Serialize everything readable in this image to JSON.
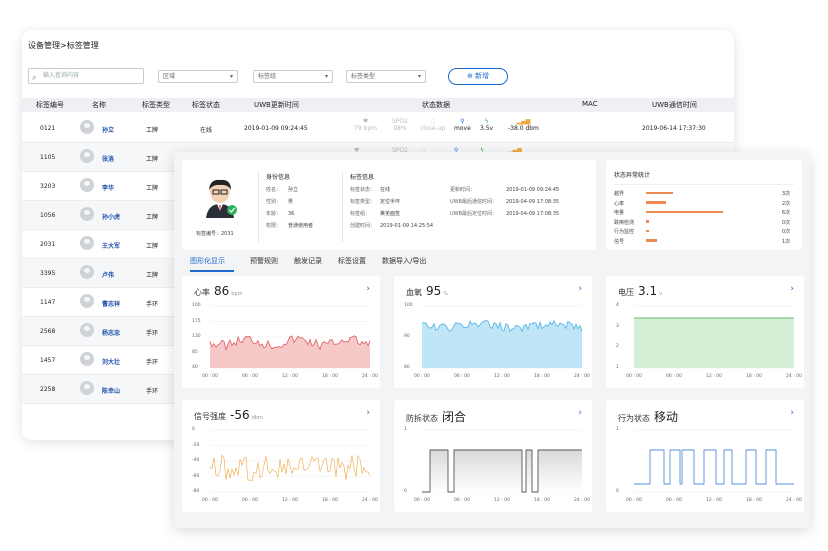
{
  "breadcrumb": "设备管理>标签管理",
  "toolbar": {
    "search_placeholder": "输入查询内容",
    "filter1": "区域",
    "filter2": "标签组",
    "filter3": "标签类型",
    "add_label": "新增"
  },
  "table": {
    "headers": [
      "标签编号",
      "名称",
      "标签类型",
      "标签状态",
      "UWB更新时间",
      "状态数据",
      "MAC",
      "UWB通信时间"
    ],
    "rows": [
      {
        "id": "0121",
        "name": "孙立",
        "type": "工牌",
        "status": "在线",
        "uwb_time": "2019-01-09 09:24:45",
        "hr": "79 bpm",
        "spo2": "98%",
        "motion": "move",
        "volt": "3.5v",
        "signal": "-38.0 dbm",
        "comm_time": "2019-06-14 17:37:30",
        "state_labels": [
          "SPO2",
          "close-up"
        ]
      },
      {
        "id": "1105",
        "name": "张洛",
        "type": "工牌",
        "status": "",
        "uwb_time": "",
        "hr": "",
        "spo2": "",
        "motion": "",
        "volt": "",
        "signal": "",
        "comm_time": "",
        "state_labels": [
          "SPO2",
          ""
        ]
      },
      {
        "id": "3203",
        "name": "李华",
        "type": "工牌"
      },
      {
        "id": "1056",
        "name": "孙小虎",
        "type": "工牌"
      },
      {
        "id": "2031",
        "name": "王大军",
        "type": "工牌"
      },
      {
        "id": "3395",
        "name": "卢伟",
        "type": "工牌"
      },
      {
        "id": "1147",
        "name": "曹志祥",
        "type": "手环"
      },
      {
        "id": "2568",
        "name": "杨志忠",
        "type": "手环"
      },
      {
        "id": "1457",
        "name": "刘大壮",
        "type": "手环"
      },
      {
        "id": "2258",
        "name": "陈幸山",
        "type": "手环"
      }
    ]
  },
  "detail": {
    "tag_no": "标签编号：2031",
    "identity_title": "身份信息",
    "identity": [
      {
        "k": "姓名：",
        "v": "孙立"
      },
      {
        "k": "性别：",
        "v": "男"
      },
      {
        "k": "年龄：",
        "v": "36"
      },
      {
        "k": "权限：",
        "v": "普通使用者"
      }
    ],
    "tag_title": "标签信息",
    "tag_info": [
      {
        "k": "标签状态：",
        "v": "在线"
      },
      {
        "k": "标签类型：",
        "v": "定位手环"
      },
      {
        "k": "标签组：",
        "v": "莱芜面签"
      },
      {
        "k": "创建时间：",
        "v": "2019-01-09 14:25:54"
      }
    ],
    "time_info": [
      {
        "k": "更新时间：",
        "v": "2019-01-09 09:24:45"
      },
      {
        "k": "UWB最后通信时间：",
        "v": "2019-04-09 17:08:35"
      },
      {
        "k": "UWB最后定位时间：",
        "v": "2019-04-09 17:08:35"
      }
    ],
    "stat_title": "状态异常统计",
    "stat_rows": [
      {
        "label": "越界",
        "value": "3次",
        "frac": 0.3
      },
      {
        "label": "心率",
        "value": "2次",
        "frac": 0.22
      },
      {
        "label": "电量",
        "value": "6次",
        "frac": 0.85
      },
      {
        "label": "跌倒检测",
        "value": "0次",
        "frac": 0.03
      },
      {
        "label": "行为监控",
        "value": "0次",
        "frac": 0.03
      },
      {
        "label": "信号",
        "value": "1次",
        "frac": 0.12
      }
    ]
  },
  "tabs": [
    "图形化显示",
    "预警规则",
    "触发记录",
    "标签设置",
    "数据导入/导出"
  ],
  "panels": {
    "hr": {
      "title": "心率",
      "value": "86",
      "unit": "bpm",
      "yticks": [
        "100",
        "175",
        "130",
        "85",
        "40"
      ],
      "color": "#e06a6a",
      "fill": "#f6c9c9"
    },
    "spo2": {
      "title": "血氧",
      "value": "95",
      "unit": "%",
      "yticks": [
        "100",
        "90",
        "80"
      ],
      "color": "#5bb7e6",
      "fill": "#bfe5f7"
    },
    "volt": {
      "title": "电压",
      "value": "3.1",
      "unit": "v",
      "yticks": [
        "4",
        "3",
        "2",
        "1"
      ],
      "color": "#5cbf6f",
      "fill": "#d3f0d6"
    },
    "signal": {
      "title": "信号强度",
      "value": "-56",
      "unit": "dbm",
      "yticks": [
        "0",
        "-20",
        "-40",
        "-60",
        "-80"
      ],
      "color": "#f0a640"
    },
    "tamper": {
      "title": "防拆状态",
      "value": "闭合",
      "yticks": [
        "1",
        "0"
      ],
      "color": "#555"
    },
    "behavior": {
      "title": "行为状态",
      "value": "移动",
      "yticks": [
        "1",
        "0"
      ],
      "color": "#5a8fdc"
    },
    "xticks": [
      "00 : 00",
      "06 : 00",
      "12 : 00",
      "18 : 00",
      "24 : 00"
    ]
  }
}
